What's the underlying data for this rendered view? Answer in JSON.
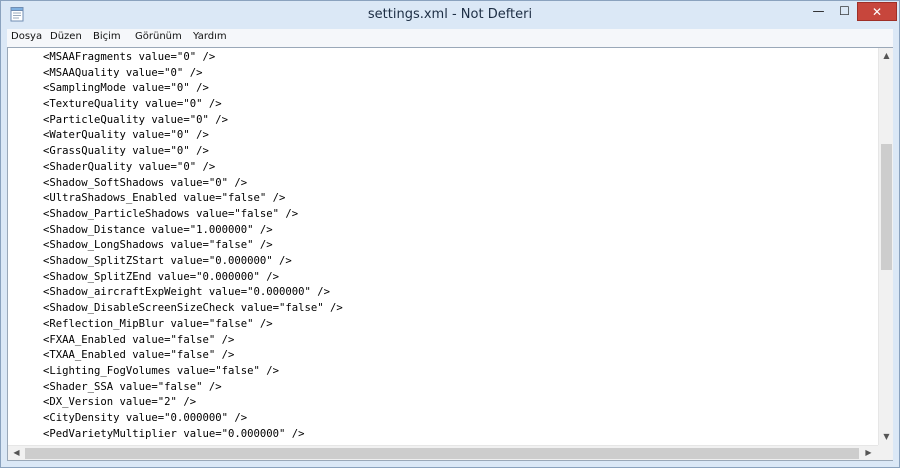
{
  "window": {
    "title": "settings.xml - Not Defteri",
    "controls": {
      "minimize": "—",
      "maximize": "☐",
      "close": "✕"
    }
  },
  "menu": [
    "Dosya",
    "Düzen",
    "Biçim",
    "Görünüm",
    "Yardım"
  ],
  "lines": [
    "<MSAAFragments value=\"0\" />",
    "<MSAAQuality value=\"0\" />",
    "<SamplingMode value=\"0\" />",
    "<TextureQuality value=\"0\" />",
    "<ParticleQuality value=\"0\" />",
    "<WaterQuality value=\"0\" />",
    "<GrassQuality value=\"0\" />",
    "<ShaderQuality value=\"0\" />",
    "<Shadow_SoftShadows value=\"0\" />",
    "<UltraShadows_Enabled value=\"false\" />",
    "<Shadow_ParticleShadows value=\"false\" />",
    "<Shadow_Distance value=\"1.000000\" />",
    "<Shadow_LongShadows value=\"false\" />",
    "<Shadow_SplitZStart value=\"0.000000\" />",
    "<Shadow_SplitZEnd value=\"0.000000\" />",
    "<Shadow_aircraftExpWeight value=\"0.000000\" />",
    "<Shadow_DisableScreenSizeCheck value=\"false\" />",
    "<Reflection_MipBlur value=\"false\" />",
    "<FXAA_Enabled value=\"false\" />",
    "<TXAA_Enabled value=\"false\" />",
    "<Lighting_FogVolumes value=\"false\" />",
    "<Shader_SSA value=\"false\" />",
    "<DX_Version value=\"2\" />",
    "<CityDensity value=\"0.000000\" />",
    "<PedVarietyMultiplier value=\"0.000000\" />"
  ],
  "scrollbar": {
    "up": "▲",
    "down": "▼",
    "left": "◀",
    "right": "▶"
  }
}
